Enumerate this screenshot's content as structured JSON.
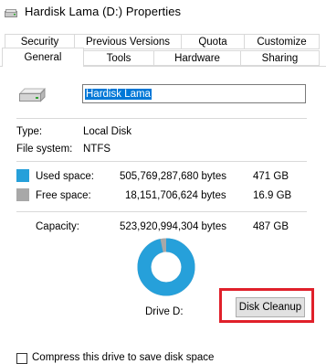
{
  "window": {
    "title": "Hardisk Lama (D:) Properties"
  },
  "tabs_back": [
    "Security",
    "Previous Versions",
    "Quota",
    "Customize"
  ],
  "tabs_front": [
    "General",
    "Tools",
    "Hardware",
    "Sharing"
  ],
  "active_tab": "General",
  "general": {
    "drive_name": "Hardisk Lama",
    "type_label": "Type:",
    "type_value": "Local Disk",
    "fs_label": "File system:",
    "fs_value": "NTFS",
    "used_label": "Used space:",
    "used_bytes": "505,769,287,680 bytes",
    "used_gb": "471 GB",
    "free_label": "Free space:",
    "free_bytes": "18,151,706,624 bytes",
    "free_gb": "16.9 GB",
    "capacity_label": "Capacity:",
    "capacity_bytes": "523,920,994,304 bytes",
    "capacity_gb": "487 GB",
    "drive_label": "Drive D:",
    "cleanup_button": "Disk Cleanup",
    "compress_label": "Compress this drive to save disk space",
    "used_fraction": 0.9654
  },
  "colors": {
    "used": "#26a0da",
    "free": "#a8a8a8",
    "highlight": "#e0202a",
    "selection": "#0078d7"
  }
}
